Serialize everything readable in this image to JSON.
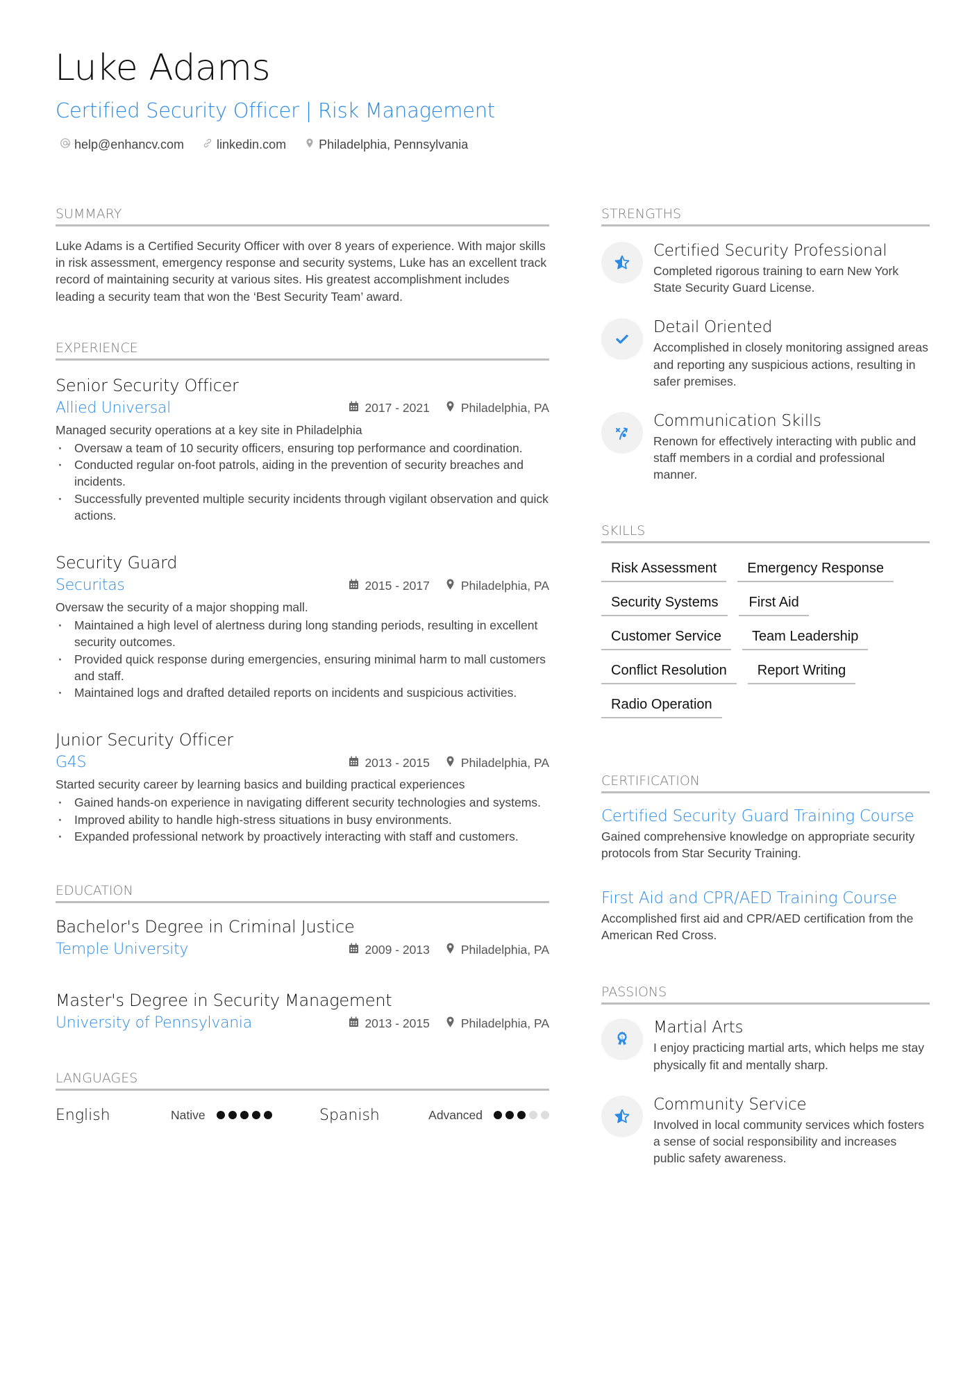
{
  "header": {
    "name": "Luke Adams",
    "title": "Certified Security Officer | Risk Management",
    "contacts": [
      {
        "icon": "at-icon",
        "text": "help@enhancv.com"
      },
      {
        "icon": "link-icon",
        "text": "linkedin.com"
      },
      {
        "icon": "location-pin-icon",
        "text": "Philadelphia, Pennsylvania"
      }
    ]
  },
  "summary": {
    "heading": "SUMMARY",
    "text": "Luke Adams is a Certified Security Officer with over 8 years of experience. With major skills in risk assessment, emergency response and security systems, Luke has an excellent track record of maintaining security at various sites. His greatest accomplishment includes leading a security team that won the ‘Best Security Team’ award."
  },
  "experience": {
    "heading": "EXPERIENCE",
    "items": [
      {
        "title": "Senior Security Officer",
        "company": "Allied Universal",
        "dates": "2017 - 2021",
        "location": "Philadelphia, PA",
        "description": "Managed security operations at a key site in Philadelphia",
        "bullets": [
          "Oversaw a team of 10 security officers, ensuring top performance and coordination.",
          "Conducted regular on-foot patrols, aiding in the prevention of security breaches and incidents.",
          "Successfully prevented multiple security incidents through vigilant observation and quick actions."
        ]
      },
      {
        "title": "Security Guard",
        "company": "Securitas",
        "dates": "2015 - 2017",
        "location": "Philadelphia, PA",
        "description": "Oversaw the security of a major shopping mall.",
        "bullets": [
          "Maintained a high level of alertness during long standing periods, resulting in excellent security outcomes.",
          "Provided quick response during emergencies, ensuring minimal harm to mall customers and staff.",
          "Maintained logs and drafted detailed reports on incidents and suspicious activities."
        ]
      },
      {
        "title": "Junior Security Officer",
        "company": "G4S",
        "dates": "2013 - 2015",
        "location": "Philadelphia, PA",
        "description": "Started security career by learning basics and building practical experiences",
        "bullets": [
          "Gained hands-on experience in navigating different security technologies and systems.",
          "Improved ability to handle high-stress situations in busy environments.",
          "Expanded professional network by proactively interacting with staff and customers."
        ]
      }
    ]
  },
  "education": {
    "heading": "EDUCATION",
    "items": [
      {
        "degree": "Bachelor's Degree in Criminal Justice",
        "school": "Temple University",
        "dates": "2009 - 2013",
        "location": "Philadelphia, PA"
      },
      {
        "degree": "Master's Degree in Security Management",
        "school": "University of Pennsylvania",
        "dates": "2013 - 2015",
        "location": "Philadelphia, PA"
      }
    ]
  },
  "languages": {
    "heading": "LANGUAGES",
    "items": [
      {
        "name": "English",
        "level": "Native",
        "dots_filled": 5,
        "dots_total": 5
      },
      {
        "name": "Spanish",
        "level": "Advanced",
        "dots_filled": 3,
        "dots_total": 5
      }
    ]
  },
  "strengths": {
    "heading": "STRENGTHS",
    "items": [
      {
        "icon": "star-half-icon",
        "title": "Certified Security Professional",
        "description": "Completed rigorous training to earn New York State Security Guard License."
      },
      {
        "icon": "checkmark-icon",
        "title": "Detail Oriented",
        "description": "Accomplished in closely monitoring assigned areas and reporting any suspicious actions, resulting in safer premises."
      },
      {
        "icon": "strategy-icon",
        "title": "Communication Skills",
        "description": "Renown for effectively interacting with public and staff members in a cordial and professional manner."
      }
    ]
  },
  "skills": {
    "heading": "SKILLS",
    "items": [
      "Risk Assessment",
      "Emergency Response",
      "Security Systems",
      "First Aid",
      "Customer Service",
      "Team Leadership",
      "Conflict Resolution",
      "Report Writing",
      "Radio Operation"
    ]
  },
  "certification": {
    "heading": "CERTIFICATION",
    "items": [
      {
        "title": "Certified Security Guard Training Course",
        "description": "Gained comprehensive knowledge on appropriate security protocols from Star Security Training."
      },
      {
        "title": "First Aid and CPR/AED Training Course",
        "description": "Accomplished first aid and CPR/AED certification from the American Red Cross."
      }
    ]
  },
  "passions": {
    "heading": "PASSIONS",
    "items": [
      {
        "icon": "medal-icon",
        "title": "Martial Arts",
        "description": "I enjoy practicing martial arts, which helps me stay physically fit and mentally sharp."
      },
      {
        "icon": "star-half-icon",
        "title": "Community Service",
        "description": "Involved in local community services which fosters a sense of social responsibility and increases public safety awareness."
      }
    ]
  },
  "colors": {
    "accent": "#2a8ae5",
    "text": "#444444",
    "heading_rule": "#bdbdbd"
  }
}
